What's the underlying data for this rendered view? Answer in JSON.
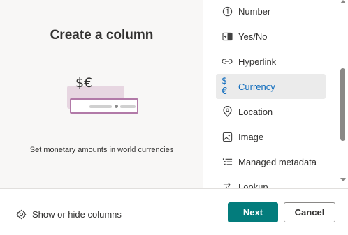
{
  "preview": {
    "title": "Create a column",
    "illustration_symbol": "$€",
    "description": "Set monetary amounts in world currencies"
  },
  "column_types": [
    {
      "label": "Number",
      "icon": "number-circle-icon",
      "selected": false
    },
    {
      "label": "Yes/No",
      "icon": "toggle-icon",
      "selected": false
    },
    {
      "label": "Hyperlink",
      "icon": "link-icon",
      "selected": false
    },
    {
      "label": "Currency",
      "icon": "currency-icon",
      "selected": true
    },
    {
      "label": "Location",
      "icon": "location-pin-icon",
      "selected": false
    },
    {
      "label": "Image",
      "icon": "image-icon",
      "selected": false
    },
    {
      "label": "Managed metadata",
      "icon": "metadata-list-icon",
      "selected": false
    },
    {
      "label": "Lookup",
      "icon": "lookup-arrow-icon",
      "selected": false
    }
  ],
  "footer": {
    "show_hide_label": "Show or hide columns",
    "next_label": "Next",
    "cancel_label": "Cancel"
  },
  "colors": {
    "primary": "#037c7c",
    "selected_bg": "#ebebeb",
    "accent_text": "#0f6cbd",
    "preview_bg": "#f8f7f6"
  }
}
